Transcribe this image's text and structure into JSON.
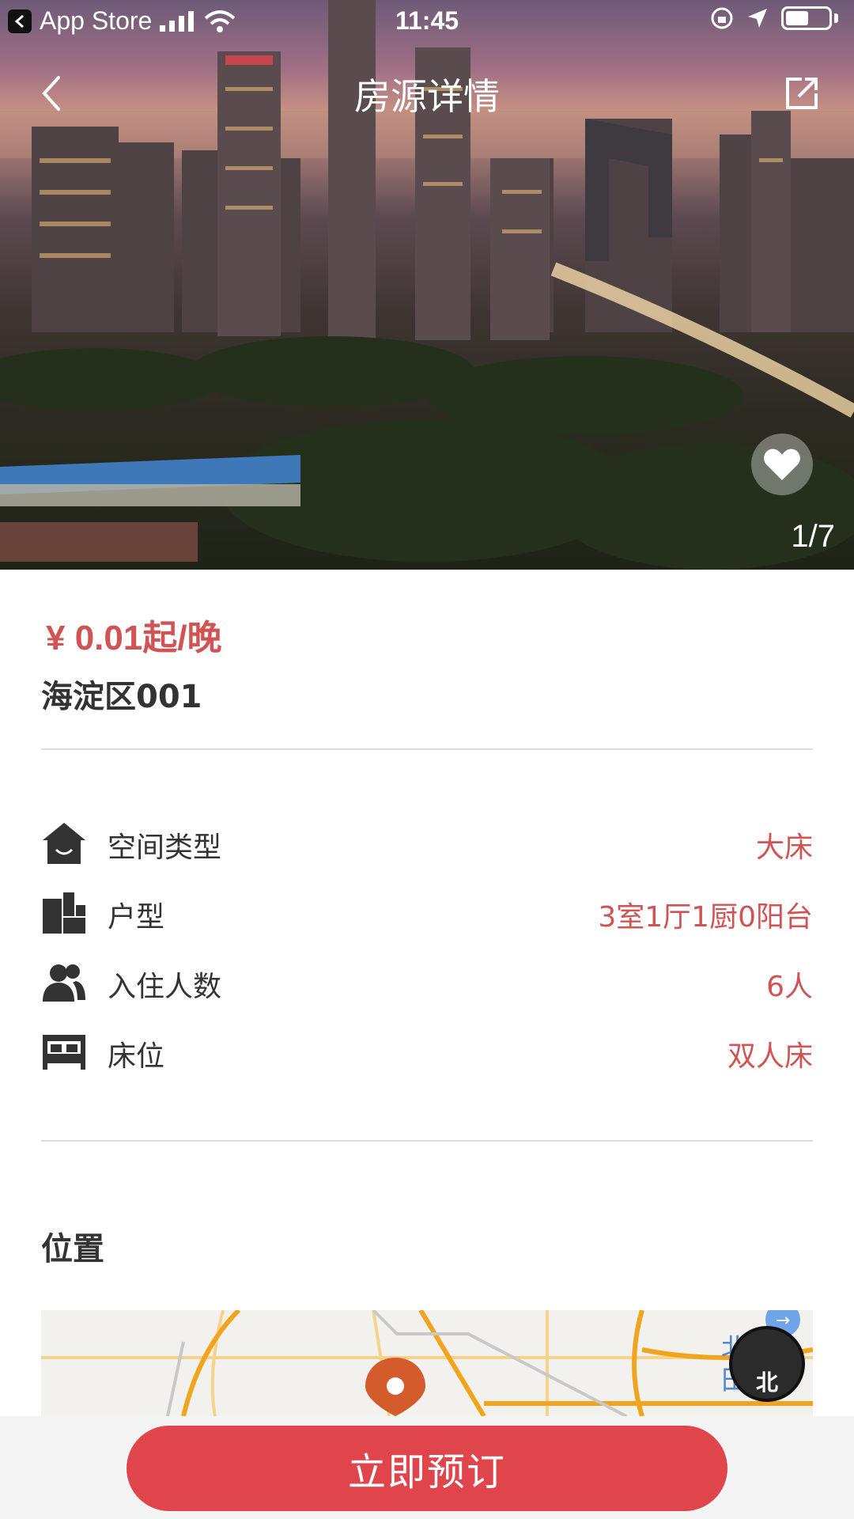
{
  "status_bar": {
    "back_app": "App Store",
    "time": "11:45"
  },
  "nav": {
    "title": "房源详情"
  },
  "gallery": {
    "counter": "1/7"
  },
  "listing": {
    "price": "¥ 0.01起/晚",
    "name": "海淀区001"
  },
  "attributes": [
    {
      "icon": "house-icon",
      "label": "空间类型",
      "value": "大床"
    },
    {
      "icon": "floorplan-icon",
      "label": "户型",
      "value": "3室1厅1厨0阳台"
    },
    {
      "icon": "people-icon",
      "label": "入住人数",
      "value": "6人"
    },
    {
      "icon": "bed-icon",
      "label": "床位",
      "value": "双人床"
    }
  ],
  "location": {
    "section_title": "位置",
    "compass_label": "北"
  },
  "actions": {
    "book_label": "立即预订"
  },
  "colors": {
    "accent_red": "#e0454c",
    "value_red": "#d05454",
    "text_dark": "#333333",
    "divider": "#dddddd"
  }
}
